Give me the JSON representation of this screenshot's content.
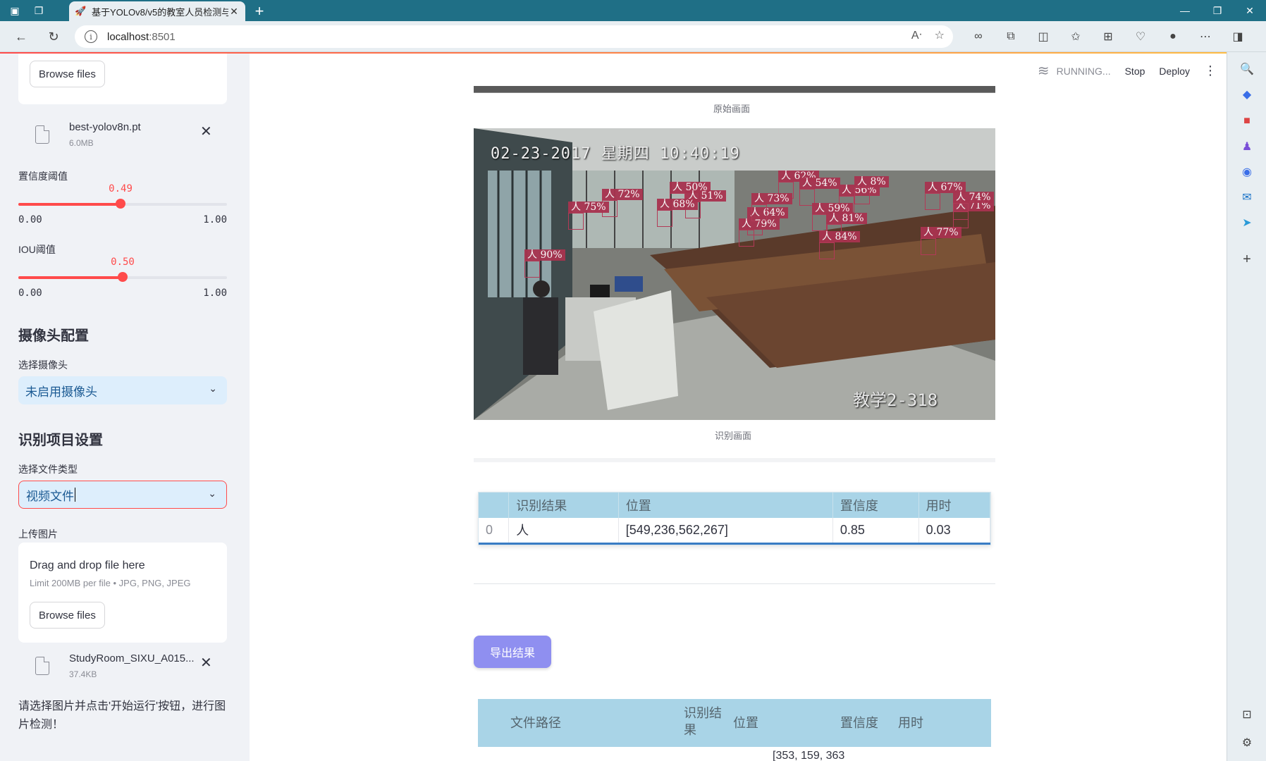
{
  "browser": {
    "tab_title": "基于YOLOv8/v5的教室人员检测与",
    "url_host": "localhost",
    "url_port": ":8501"
  },
  "app": {
    "status": "RUNNING...",
    "stop_label": "Stop",
    "deploy_label": "Deploy"
  },
  "sidebar": {
    "model_uploader": {
      "browse_label": "Browse files"
    },
    "model_file": {
      "name": "best-yolov8n.pt",
      "size": "6.0MB"
    },
    "conf_slider": {
      "label": "置信度阈值",
      "value": "0.49",
      "value_num": 0.49,
      "min": "0.00",
      "max": "1.00"
    },
    "iou_slider": {
      "label": "IOU阈值",
      "value": "0.50",
      "value_num": 0.5,
      "min": "0.00",
      "max": "1.00"
    },
    "camera_header": "摄像头配置",
    "camera_select_label": "选择摄像头",
    "camera_select_value": "未启用摄像头",
    "recognition_header": "识别项目设置",
    "filetype_label": "选择文件类型",
    "filetype_value": "视频文件",
    "upload_label": "上传图片",
    "uploader": {
      "drop_text": "Drag and drop file here",
      "limit_text": "Limit 200MB per file • JPG, PNG, JPEG",
      "browse_label": "Browse files"
    },
    "uploaded_file": {
      "name": "StudyRoom_SIXU_A015...",
      "size": "37.4KB"
    },
    "info_text": "请选择图片并点击'开始运行'按钮，进行图片检测！"
  },
  "main": {
    "original_caption": "原始画面",
    "detect_caption": "识别画面",
    "frame_timestamp": "02-23-2017 星期四 10:40:19",
    "frame_room": "教学2-318",
    "detections": [
      {
        "text": "人 90%"
      },
      {
        "text": "人 72%"
      },
      {
        "text": "人 75%"
      },
      {
        "text": "人 50%"
      },
      {
        "text": "人 51%"
      },
      {
        "text": "人 62%"
      },
      {
        "text": "人 54%"
      },
      {
        "text": "人 56%"
      },
      {
        "text": "人 67%"
      },
      {
        "text": "人 64%"
      },
      {
        "text": "人 79%"
      },
      {
        "text": "人 59%"
      },
      {
        "text": "人 81%"
      },
      {
        "text": "人 84%"
      },
      {
        "text": "人 77%"
      },
      {
        "text": "人 71%"
      },
      {
        "text": "人 74%"
      },
      {
        "text": "人 68%"
      },
      {
        "text": "人 73%"
      },
      {
        "text": "人 8%"
      }
    ],
    "result_table": {
      "headers": [
        "",
        "识别结果",
        "位置",
        "置信度",
        "用时"
      ],
      "rows": [
        [
          "0",
          "人",
          "[549,236,562,267]",
          "0.85",
          "0.03"
        ]
      ]
    },
    "export_label": "导出结果",
    "log_table": {
      "headers": [
        "文件路径",
        "识别结果",
        "位置",
        "置信度",
        "用时"
      ],
      "partial_cell": "[353, 159, 363"
    }
  }
}
